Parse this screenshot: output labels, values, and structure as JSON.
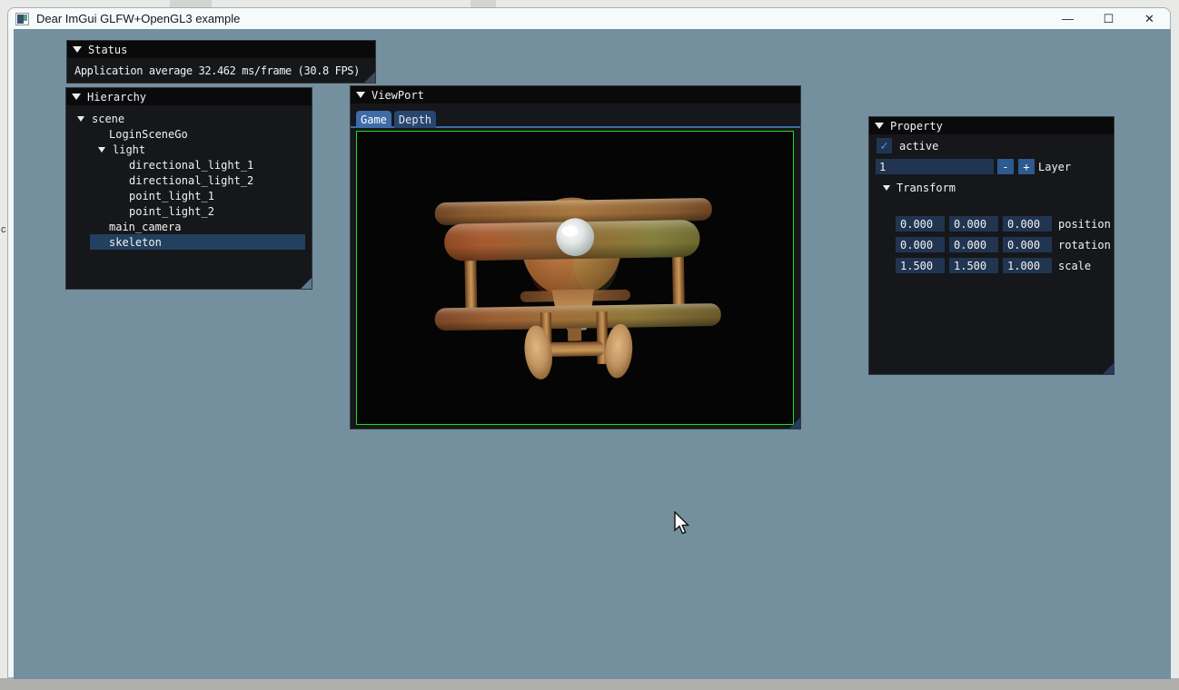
{
  "window": {
    "title": "Dear ImGui GLFW+OpenGL3 example",
    "minimize_glyph": "—",
    "maximize_glyph": "☐",
    "close_glyph": "✕"
  },
  "desktop": {
    "artifact_text": "c"
  },
  "status_panel": {
    "title": "Status",
    "message": "Application average 32.462 ms/frame (30.8 FPS)"
  },
  "hierarchy_panel": {
    "title": "Hierarchy",
    "tree": [
      {
        "label": "scene"
      },
      {
        "label": "LoginSceneGo"
      },
      {
        "label": "light"
      },
      {
        "label": "directional_light_1"
      },
      {
        "label": "directional_light_2"
      },
      {
        "label": "point_light_1"
      },
      {
        "label": "point_light_2"
      },
      {
        "label": "main_camera"
      },
      {
        "label": "skeleton"
      }
    ],
    "selected_item": "skeleton"
  },
  "viewport_panel": {
    "title": "ViewPort",
    "tabs": [
      {
        "label": "Game"
      },
      {
        "label": "Depth"
      }
    ],
    "active_tab": "Game"
  },
  "property_panel": {
    "title": "Property",
    "active_label": "active",
    "layer": {
      "value": "1",
      "decrement": "-",
      "increment": "+",
      "label": "Layer"
    },
    "transform": {
      "title": "Transform",
      "rows": [
        {
          "x": "0.000",
          "y": "0.000",
          "z": "0.000",
          "label": "position"
        },
        {
          "x": "0.000",
          "y": "0.000",
          "z": "0.000",
          "label": "rotation"
        },
        {
          "x": "1.500",
          "y": "1.500",
          "z": "1.000",
          "label": "scale"
        }
      ]
    }
  },
  "colors": {
    "gl_background": "#74909E",
    "panel_bg": "#15171A",
    "panel_titlebar": "#0A0A0A",
    "accent_blue": "#4296FA",
    "frame_bg": "#213551",
    "button_bg": "#2D5A8F",
    "tab_active": "#3E6CA8",
    "tab_inactive": "#28466F",
    "selection": "#22405F",
    "viewport_border": "#1EDC1E"
  }
}
